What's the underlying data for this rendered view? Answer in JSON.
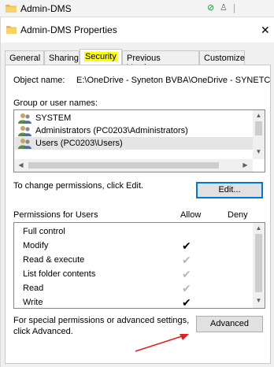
{
  "background_window": {
    "title": "Admin-DMS",
    "status_icon": "sync-ok-icon",
    "person_icon": "person-icon"
  },
  "dialog": {
    "title": "Admin-DMS Properties",
    "close_glyph": "✕"
  },
  "tabs": [
    {
      "label": "General",
      "active": false
    },
    {
      "label": "Sharing",
      "active": false
    },
    {
      "label": "Security",
      "active": true
    },
    {
      "label": "Previous Versions",
      "active": false
    },
    {
      "label": "Customize",
      "active": false
    }
  ],
  "security": {
    "object_name_label": "Object name:",
    "object_name_value": "E:\\OneDrive - Syneton BVBA\\OneDrive - SYNETC",
    "group_label": "Group or user names:",
    "groups": [
      {
        "name": "SYSTEM",
        "selected": false
      },
      {
        "name": "Administrators (PC0203\\Administrators)",
        "selected": false
      },
      {
        "name": "Users (PC0203\\Users)",
        "selected": true
      }
    ],
    "change_text": "To change permissions, click Edit.",
    "edit_button": "Edit...",
    "permissions_label": "Permissions for Users",
    "allow_header": "Allow",
    "deny_header": "Deny",
    "permissions": [
      {
        "name": "Full control",
        "allow": false,
        "allow_inherited": false
      },
      {
        "name": "Modify",
        "allow": true,
        "allow_inherited": false
      },
      {
        "name": "Read & execute",
        "allow": true,
        "allow_inherited": true
      },
      {
        "name": "List folder contents",
        "allow": true,
        "allow_inherited": true
      },
      {
        "name": "Read",
        "allow": true,
        "allow_inherited": true
      },
      {
        "name": "Write",
        "allow": true,
        "allow_inherited": false
      }
    ],
    "special_text_line1": "For special permissions or advanced settings,",
    "special_text_line2": "click Advanced.",
    "advanced_button": "Advanced"
  },
  "colors": {
    "tab_highlight": "#ffff00",
    "annotation_arrow": "#e02020",
    "focus_border": "#0078d7"
  }
}
